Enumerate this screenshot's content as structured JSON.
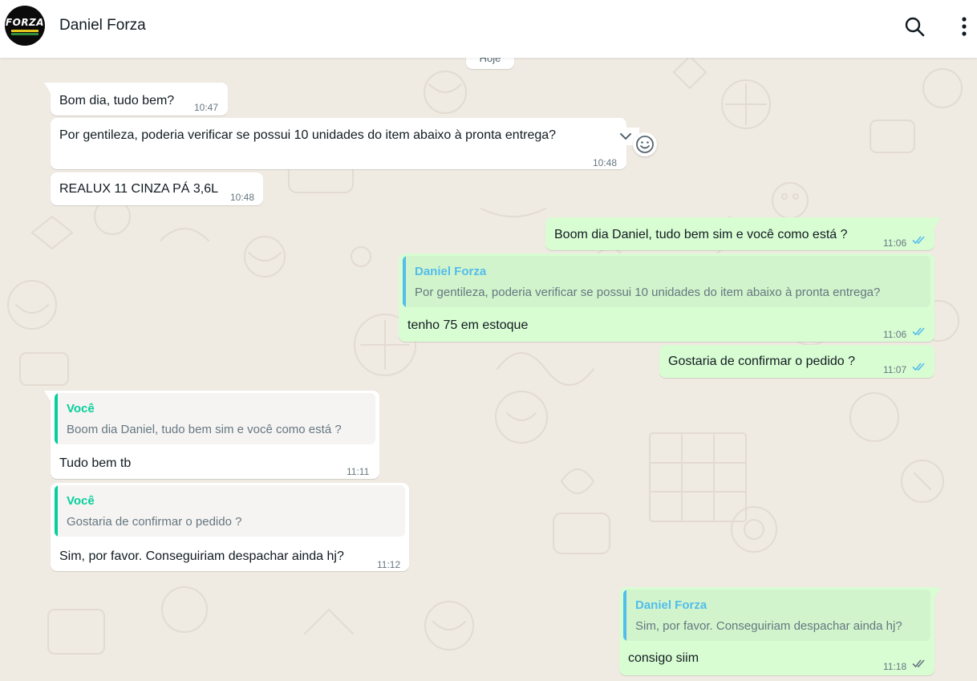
{
  "header": {
    "contact_name": "Daniel Forza",
    "avatar_text": "FORZA",
    "search_icon": "search-icon",
    "menu_icon": "kebab-menu-icon"
  },
  "day_separator": "Hoje",
  "messages": [
    {
      "dir": "in",
      "text": "Bom dia, tudo bem?",
      "time": "10:47"
    },
    {
      "dir": "in",
      "text": "Por gentileza, poderia verificar se possui 10 unidades do item abaixo à pronta entrega?",
      "time": "10:48"
    },
    {
      "dir": "in",
      "text": "REALUX 11 CINZA PÁ 3,6L",
      "time": "10:48"
    },
    {
      "dir": "out",
      "text": "Boom dia Daniel, tudo bem sim e você como está ?",
      "time": "11:06",
      "status": "read"
    },
    {
      "dir": "out",
      "quote_author": "Daniel Forza",
      "quote_text": "Por gentileza, poderia verificar se possui 10 unidades do item abaixo à pronta entrega?",
      "text": "tenho 75 em estoque",
      "time": "11:06",
      "status": "read"
    },
    {
      "dir": "out",
      "text": "Gostaria de confirmar o pedido ?",
      "time": "11:07",
      "status": "read"
    },
    {
      "dir": "in",
      "quote_author": "Você",
      "quote_text": "Boom dia Daniel, tudo bem sim e você como está ?",
      "text": "Tudo bem tb",
      "time": "11:11"
    },
    {
      "dir": "in",
      "quote_author": "Você",
      "quote_text": "Gostaria de confirmar o pedido ?",
      "text": "Sim, por favor. Conseguiriam despachar ainda hj?",
      "time": "11:12"
    },
    {
      "dir": "out",
      "quote_author": "Daniel Forza",
      "quote_text": "Sim, por favor. Conseguiriam despachar ainda hj?",
      "text": "consigo siim",
      "time": "11:18",
      "status": "delivered"
    }
  ],
  "colors": {
    "background": "#efeae2",
    "incoming_bubble": "#ffffff",
    "outgoing_bubble": "#d9fdd3",
    "read_ticks": "#53bdeb",
    "delivered_ticks": "#667781",
    "quote_you": "#06cf9c",
    "quote_contact": "#53bdeb"
  }
}
